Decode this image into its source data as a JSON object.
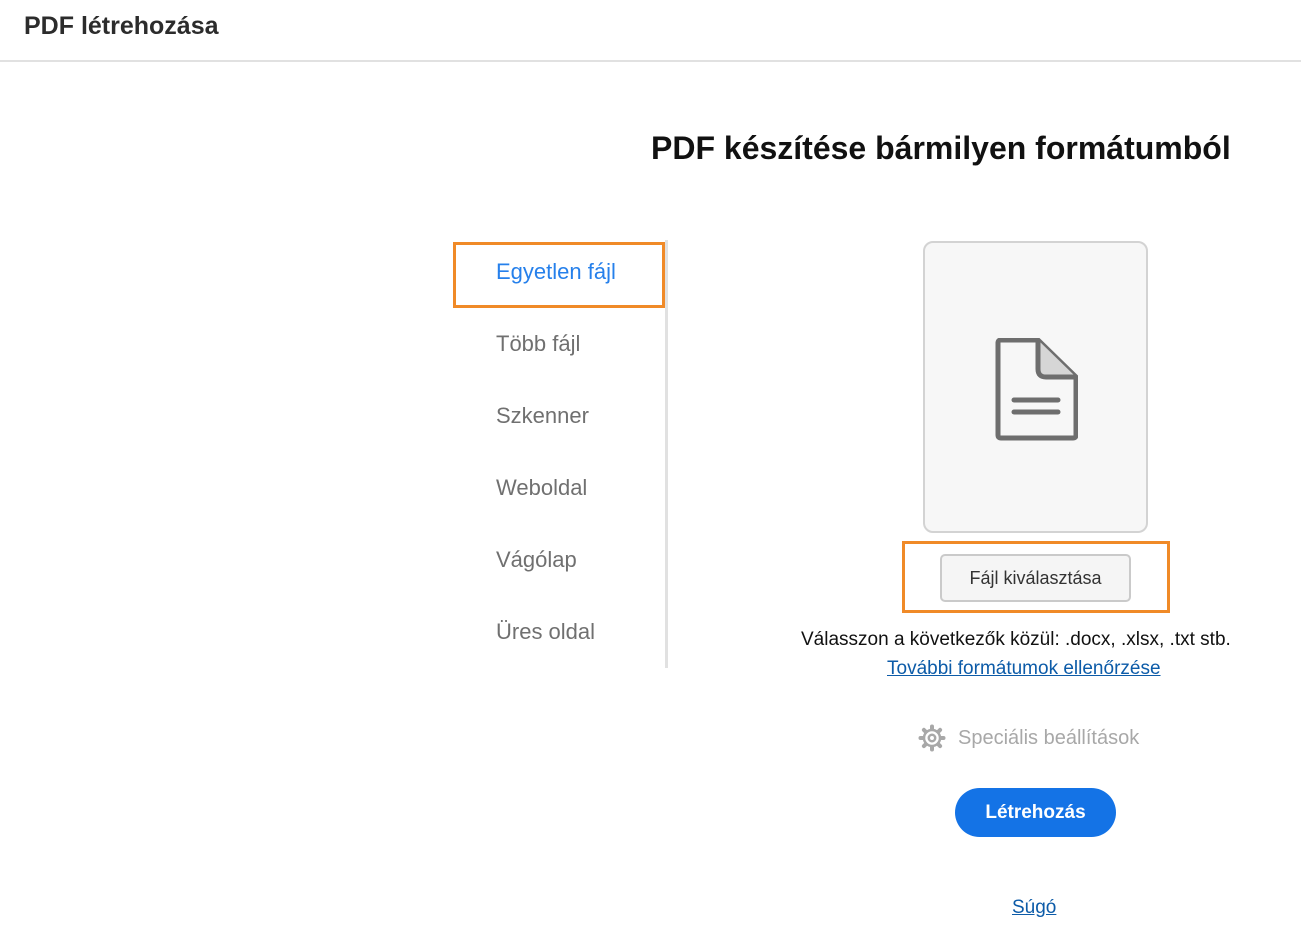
{
  "header": {
    "title": "PDF létrehozása"
  },
  "main": {
    "heading": "PDF készítése bármilyen formátumból",
    "nav_items": [
      {
        "label": "Egyetlen fájl",
        "active": true
      },
      {
        "label": "Több fájl",
        "active": false
      },
      {
        "label": "Szkenner",
        "active": false
      },
      {
        "label": "Weboldal",
        "active": false
      },
      {
        "label": "Vágólap",
        "active": false
      },
      {
        "label": "Üres oldal",
        "active": false
      }
    ],
    "dropzone": {
      "icon": "document-icon"
    },
    "choose_file_label": "Fájl kiválasztása",
    "formats_hint": "Válasszon a következők közül: .docx, .xlsx, .txt stb.",
    "more_formats_link": "További formátumok ellenőrzése",
    "advanced_settings": {
      "icon": "gear-icon",
      "label": "Speciális beállítások"
    },
    "create_button": "Létrehozás",
    "help_link": "Súgó"
  },
  "colors": {
    "accent": "#1473e6",
    "active_nav": "#2680eb",
    "highlight_frame": "#f08a28",
    "link": "#0c5ba8"
  }
}
